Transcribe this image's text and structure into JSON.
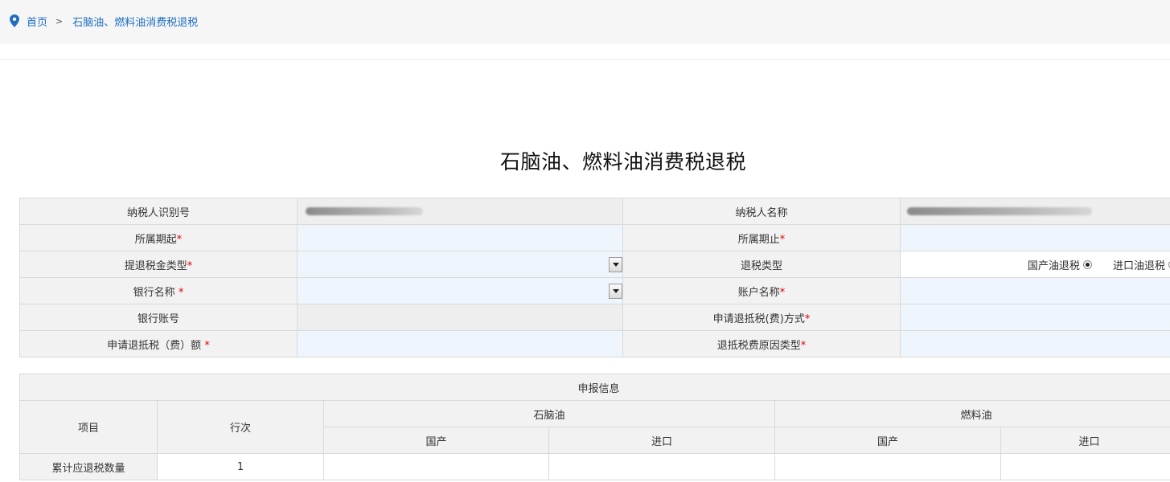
{
  "breadcrumb": {
    "home": "首页",
    "separator": ">",
    "current": "石脑油、燃料油消费税退税"
  },
  "page": {
    "title": "石脑油、燃料油消费税退税"
  },
  "form": {
    "taxpayer_id_label": "纳税人识别号",
    "taxpayer_name_label": "纳税人名称",
    "period_start_label": "所属期起",
    "period_end_label": "所属期止",
    "refund_fund_type_label": "提退税金类型",
    "refund_type_label": "退税类型",
    "refund_type_options": [
      "国产油退税",
      "进口油退税"
    ],
    "refund_type_selected": "国产油退税",
    "bank_name_label": "银行名称 ",
    "account_name_label": "账户名称",
    "bank_account_label": "银行账号",
    "apply_method_label": "申请退抵税(费)方式",
    "apply_amount_label": "申请退抵税（费）额 ",
    "reason_type_label": "退抵税费原因类型",
    "required_mark": "*"
  },
  "declaration": {
    "section_title": "申报信息",
    "col_item": "项目",
    "col_row_no": "行次",
    "naphtha": "石脑油",
    "fuel_oil": "燃料油",
    "domestic": "国产",
    "imported": "进口",
    "rows": [
      {
        "item": "累计应退税数量",
        "row_no": "1"
      }
    ]
  },
  "colors": {
    "link": "#1e6fc0",
    "required": "#e00000",
    "input_bg": "#eef5fd",
    "label_bg": "#f2f2f2"
  }
}
